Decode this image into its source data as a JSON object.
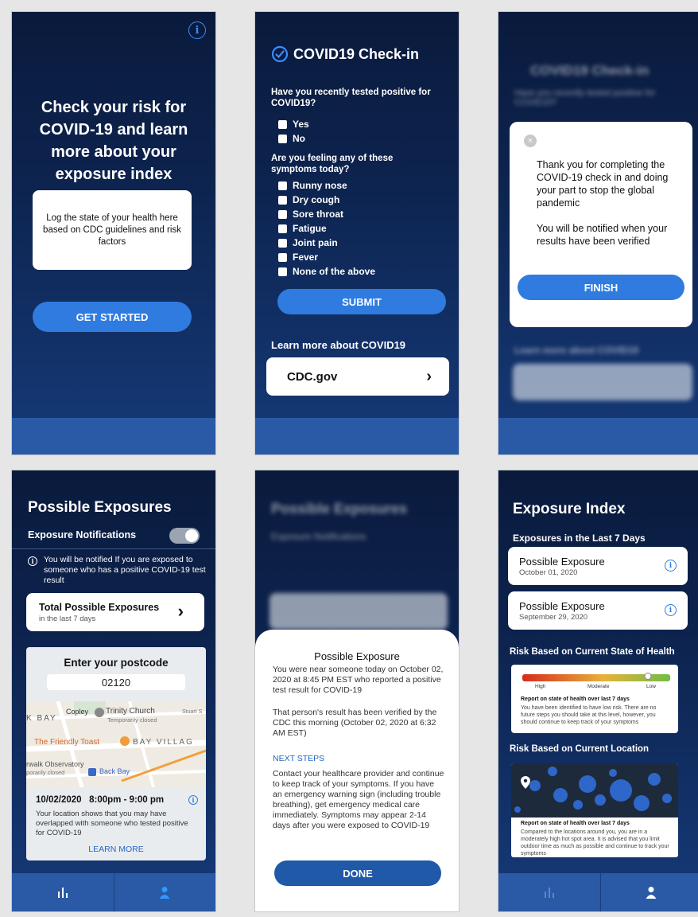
{
  "s1": {
    "headline": "Check your risk for COVID-19 and learn more about your exposure index",
    "card_text": "Log the state of your health here based on CDC guidelines and risk factors",
    "cta": "GET STARTED"
  },
  "checkin": {
    "title": "COVID19 Check-in",
    "q1": "Have you recently tested positive for COVID19?",
    "q1_options": [
      "Yes",
      "No"
    ],
    "q2": "Are you feeling any of these symptoms today?",
    "q2_options": [
      "Runny nose",
      "Dry cough",
      "Sore throat",
      "Fatigue",
      "Joint pain",
      "Fever",
      "None of the above"
    ],
    "submit": "SUBMIT",
    "learn": "Learn more about COVID19",
    "link": "CDC.gov"
  },
  "s3": {
    "modal_p1": "Thank you for completing the COVID-19 check in and doing your part to stop the global pandemic",
    "modal_p2": "You will be notified when your results have been verified",
    "finish": "FINISH"
  },
  "s4": {
    "title": "Possible Exposures",
    "notif_label": "Exposure Notifications",
    "notif_note": "You will be notified If you are exposed to someone who has a positive COVID-19 test result",
    "total_title": "Total Possible Exposures",
    "total_sub": "in the last 7 days",
    "postcode_label": "Enter your postcode",
    "postcode_value": "02120",
    "map_labels": {
      "copley": "Copley",
      "trinity": "Trinity Church",
      "trinity_sub": "Temporarily closed",
      "bay": "K BAY",
      "toast": "The Friendly Toast",
      "bayv": "BAY VILLAG",
      "obs": "rwalk Observatory",
      "obs_sub": "porarily closed",
      "backbay": "Back Bay",
      "stuart": "Stuart S"
    },
    "event_time": "10/02/2020   8:00pm - 9:00 pm",
    "event_desc": "Your location shows that you may have overlapped with someone who tested positive for COVID-19",
    "learn_more": "LEARN MORE"
  },
  "s5": {
    "sheet_title": "Possible Exposure",
    "p1": "You were near someone today on October 02, 2020 at 8:45 PM EST who reported a positive test result for COVID-19",
    "p2": "That person's result has been verified by the CDC this morning (October 02, 2020 at 6:32 AM EST)",
    "next_steps": "NEXT STEPS",
    "p3": "Contact your healthcare provider and continue to keep track of your symptoms. If you have an emergency warning sign (including trouble breathing), get emergency medical care immediately. Symptoms may appear 2-14 days after you were exposed to COVID-19",
    "done": "DONE"
  },
  "s6": {
    "title": "Exposure Index",
    "section1": "Exposures in the Last 7 Days",
    "exposures": [
      {
        "title": "Possible Exposure",
        "date": "October 01, 2020"
      },
      {
        "title": "Possible Exposure",
        "date": "September 29, 2020"
      }
    ],
    "section2": "Risk Based on Current State of Health",
    "scale": [
      "High",
      "Moderate",
      "Low"
    ],
    "risk_level": 0.85,
    "report_title": "Report on state of health over last 7 days",
    "report_text": "You have been identified to have low risk. There are no future steps you should take at this level, however, you should continue to keep track of your symptoms",
    "section3": "Risk Based on Current Location",
    "loc_title": "Report on state of health over last 7 days",
    "loc_text": "Compared to the locations around you, you are in a moderately high hot spot area. It is advised that you limit outdoor time as much as possible and continue to track your symptoms"
  },
  "colors": {
    "primary": "#2f7be0",
    "navy": "#0d2450",
    "tabbar": "#2a5aa6",
    "link": "#2366c4"
  }
}
